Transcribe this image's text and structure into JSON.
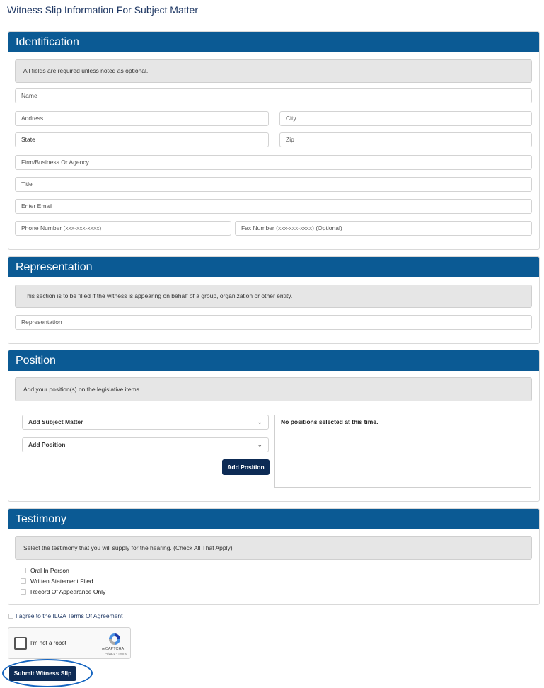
{
  "page": {
    "title": "Witness Slip Information For Subject Matter"
  },
  "identification": {
    "heading": "Identification",
    "note": "All fields are required unless noted as optional.",
    "name_placeholder": "Name",
    "address_placeholder": "Address",
    "city_placeholder": "City",
    "state_placeholder": "State",
    "zip_placeholder": "Zip",
    "firm_placeholder": "Firm/Business Or Agency",
    "title_placeholder": "Title",
    "email_placeholder": "Enter Email",
    "phone_label": "Phone Number",
    "phone_format": "(xxx-xxx-xxxx)",
    "fax_label": "Fax Number",
    "fax_format": "(xxx-xxx-xxxx)",
    "fax_optional": "(Optional)"
  },
  "representation": {
    "heading": "Representation",
    "note": "This section is to be filled if the witness is appearing on behalf of a group, organization or other entity.",
    "placeholder": "Representation"
  },
  "position": {
    "heading": "Position",
    "note": "Add your position(s) on the legislative items.",
    "subject_select": "Add Subject Matter",
    "position_select": "Add Position",
    "add_button": "Add Position",
    "empty_message": "No positions selected at this time."
  },
  "testimony": {
    "heading": "Testimony",
    "note": "Select the testimony that you will supply for the hearing. (Check All That Apply)",
    "options": [
      "Oral In Person",
      "Written Statement Filed",
      "Record Of Appearance Only"
    ]
  },
  "agreement": {
    "label": "I agree to the ILGA Terms Of Agreement"
  },
  "recaptcha": {
    "label": "I'm not a robot",
    "brand": "reCAPTCHA",
    "links": "Privacy - Terms"
  },
  "submit": {
    "label": "Submit Witness Slip"
  },
  "colors": {
    "header_blue": "#0b5a94",
    "button_navy": "#0d2b55",
    "title_navy": "#1f3864"
  }
}
